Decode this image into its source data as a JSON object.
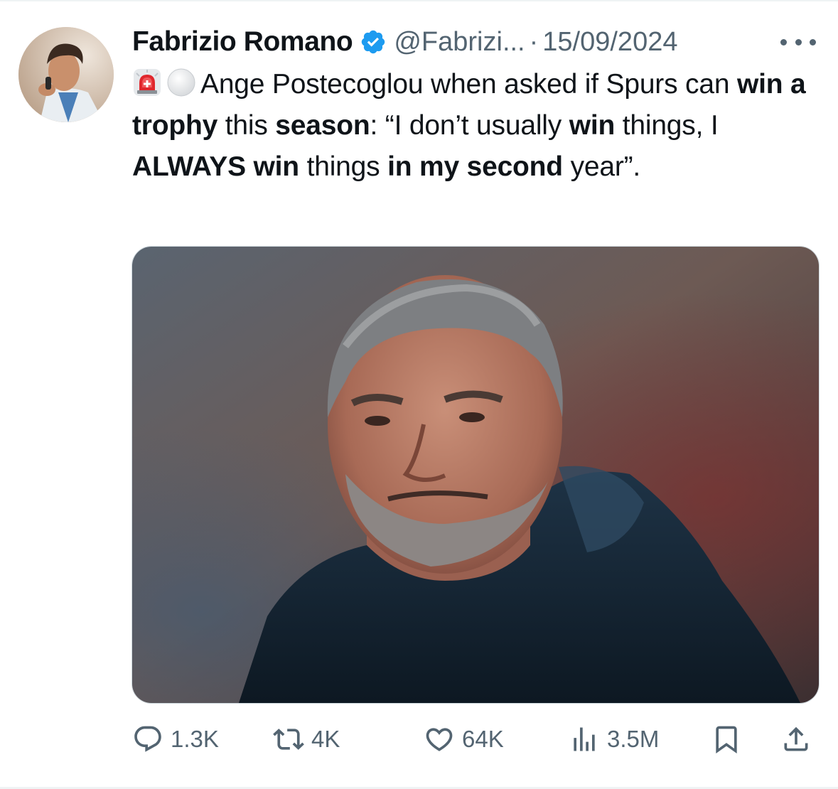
{
  "tweet": {
    "author_name": "Fabrizio Romano",
    "handle": "@Fabrizi...",
    "separator": "·",
    "date": "15/09/2024",
    "verified": true,
    "accent_color": "#1d9bf0",
    "text_segments": [
      {
        "text": "Ange Postecoglou when asked if Spurs can ",
        "bold": false
      },
      {
        "text": "win a trophy",
        "bold": true
      },
      {
        "text": " this ",
        "bold": false
      },
      {
        "text": "season",
        "bold": true
      },
      {
        "text": ": “I don’t usually ",
        "bold": false
      },
      {
        "text": "win",
        "bold": true
      },
      {
        "text": " things, I ",
        "bold": false
      },
      {
        "text": "ALWAYS win",
        "bold": true
      },
      {
        "text": " things ",
        "bold": false
      },
      {
        "text": "in my second",
        "bold": true
      },
      {
        "text": " year”.",
        "bold": false
      }
    ],
    "emojis": [
      "siren-emoji",
      "white-circle-emoji"
    ],
    "media": {
      "type": "photo"
    },
    "actions": {
      "replies": "1.3K",
      "reposts": "4K",
      "likes": "64K",
      "views": "3.5M"
    }
  }
}
